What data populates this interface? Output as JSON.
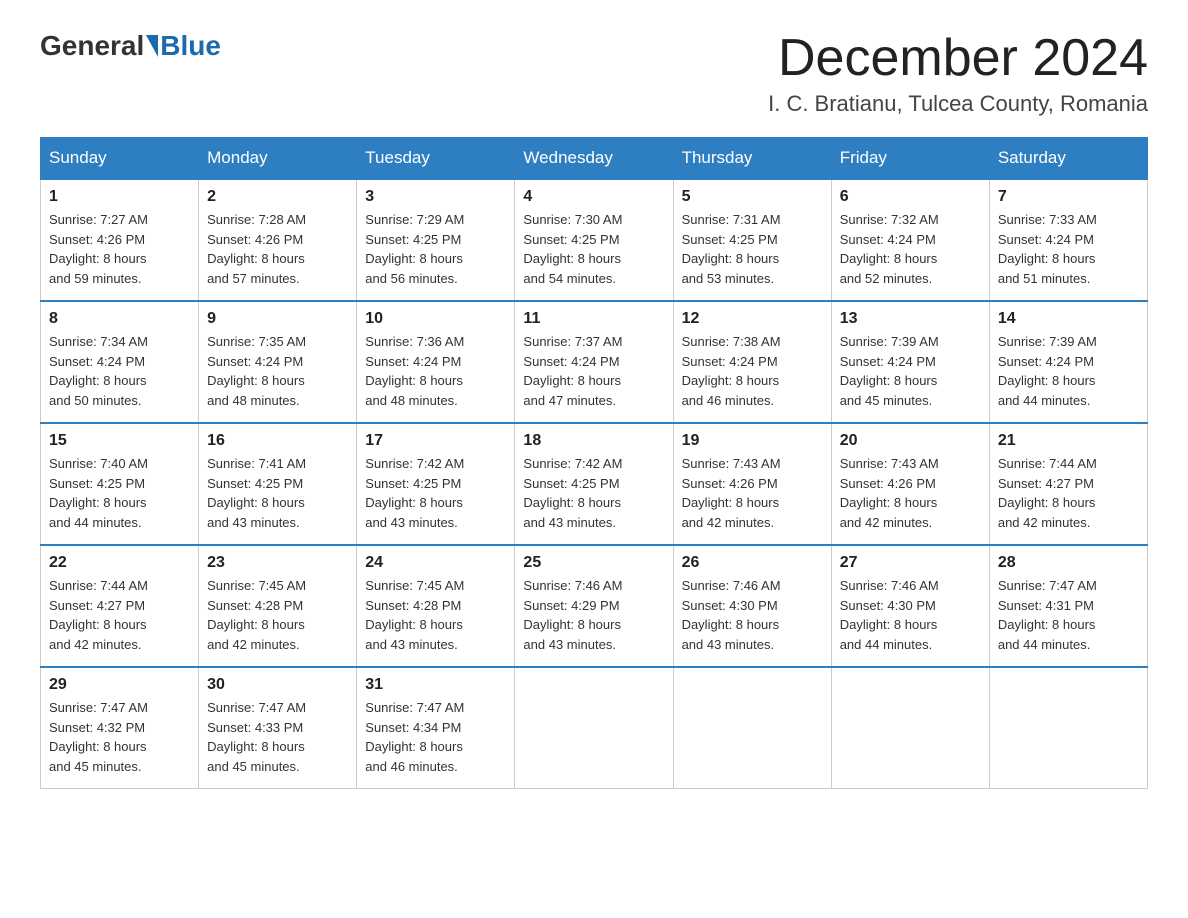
{
  "header": {
    "logo_general": "General",
    "logo_blue": "Blue",
    "month_year": "December 2024",
    "location": "I. C. Bratianu, Tulcea County, Romania"
  },
  "weekdays": [
    "Sunday",
    "Monday",
    "Tuesday",
    "Wednesday",
    "Thursday",
    "Friday",
    "Saturday"
  ],
  "weeks": [
    [
      {
        "day": "1",
        "sunrise": "7:27 AM",
        "sunset": "4:26 PM",
        "daylight": "8 hours and 59 minutes."
      },
      {
        "day": "2",
        "sunrise": "7:28 AM",
        "sunset": "4:26 PM",
        "daylight": "8 hours and 57 minutes."
      },
      {
        "day": "3",
        "sunrise": "7:29 AM",
        "sunset": "4:25 PM",
        "daylight": "8 hours and 56 minutes."
      },
      {
        "day": "4",
        "sunrise": "7:30 AM",
        "sunset": "4:25 PM",
        "daylight": "8 hours and 54 minutes."
      },
      {
        "day": "5",
        "sunrise": "7:31 AM",
        "sunset": "4:25 PM",
        "daylight": "8 hours and 53 minutes."
      },
      {
        "day": "6",
        "sunrise": "7:32 AM",
        "sunset": "4:24 PM",
        "daylight": "8 hours and 52 minutes."
      },
      {
        "day": "7",
        "sunrise": "7:33 AM",
        "sunset": "4:24 PM",
        "daylight": "8 hours and 51 minutes."
      }
    ],
    [
      {
        "day": "8",
        "sunrise": "7:34 AM",
        "sunset": "4:24 PM",
        "daylight": "8 hours and 50 minutes."
      },
      {
        "day": "9",
        "sunrise": "7:35 AM",
        "sunset": "4:24 PM",
        "daylight": "8 hours and 48 minutes."
      },
      {
        "day": "10",
        "sunrise": "7:36 AM",
        "sunset": "4:24 PM",
        "daylight": "8 hours and 48 minutes."
      },
      {
        "day": "11",
        "sunrise": "7:37 AM",
        "sunset": "4:24 PM",
        "daylight": "8 hours and 47 minutes."
      },
      {
        "day": "12",
        "sunrise": "7:38 AM",
        "sunset": "4:24 PM",
        "daylight": "8 hours and 46 minutes."
      },
      {
        "day": "13",
        "sunrise": "7:39 AM",
        "sunset": "4:24 PM",
        "daylight": "8 hours and 45 minutes."
      },
      {
        "day": "14",
        "sunrise": "7:39 AM",
        "sunset": "4:24 PM",
        "daylight": "8 hours and 44 minutes."
      }
    ],
    [
      {
        "day": "15",
        "sunrise": "7:40 AM",
        "sunset": "4:25 PM",
        "daylight": "8 hours and 44 minutes."
      },
      {
        "day": "16",
        "sunrise": "7:41 AM",
        "sunset": "4:25 PM",
        "daylight": "8 hours and 43 minutes."
      },
      {
        "day": "17",
        "sunrise": "7:42 AM",
        "sunset": "4:25 PM",
        "daylight": "8 hours and 43 minutes."
      },
      {
        "day": "18",
        "sunrise": "7:42 AM",
        "sunset": "4:25 PM",
        "daylight": "8 hours and 43 minutes."
      },
      {
        "day": "19",
        "sunrise": "7:43 AM",
        "sunset": "4:26 PM",
        "daylight": "8 hours and 42 minutes."
      },
      {
        "day": "20",
        "sunrise": "7:43 AM",
        "sunset": "4:26 PM",
        "daylight": "8 hours and 42 minutes."
      },
      {
        "day": "21",
        "sunrise": "7:44 AM",
        "sunset": "4:27 PM",
        "daylight": "8 hours and 42 minutes."
      }
    ],
    [
      {
        "day": "22",
        "sunrise": "7:44 AM",
        "sunset": "4:27 PM",
        "daylight": "8 hours and 42 minutes."
      },
      {
        "day": "23",
        "sunrise": "7:45 AM",
        "sunset": "4:28 PM",
        "daylight": "8 hours and 42 minutes."
      },
      {
        "day": "24",
        "sunrise": "7:45 AM",
        "sunset": "4:28 PM",
        "daylight": "8 hours and 43 minutes."
      },
      {
        "day": "25",
        "sunrise": "7:46 AM",
        "sunset": "4:29 PM",
        "daylight": "8 hours and 43 minutes."
      },
      {
        "day": "26",
        "sunrise": "7:46 AM",
        "sunset": "4:30 PM",
        "daylight": "8 hours and 43 minutes."
      },
      {
        "day": "27",
        "sunrise": "7:46 AM",
        "sunset": "4:30 PM",
        "daylight": "8 hours and 44 minutes."
      },
      {
        "day": "28",
        "sunrise": "7:47 AM",
        "sunset": "4:31 PM",
        "daylight": "8 hours and 44 minutes."
      }
    ],
    [
      {
        "day": "29",
        "sunrise": "7:47 AM",
        "sunset": "4:32 PM",
        "daylight": "8 hours and 45 minutes."
      },
      {
        "day": "30",
        "sunrise": "7:47 AM",
        "sunset": "4:33 PM",
        "daylight": "8 hours and 45 minutes."
      },
      {
        "day": "31",
        "sunrise": "7:47 AM",
        "sunset": "4:34 PM",
        "daylight": "8 hours and 46 minutes."
      },
      null,
      null,
      null,
      null
    ]
  ],
  "labels": {
    "sunrise_prefix": "Sunrise: ",
    "sunset_prefix": "Sunset: ",
    "daylight_prefix": "Daylight: "
  }
}
